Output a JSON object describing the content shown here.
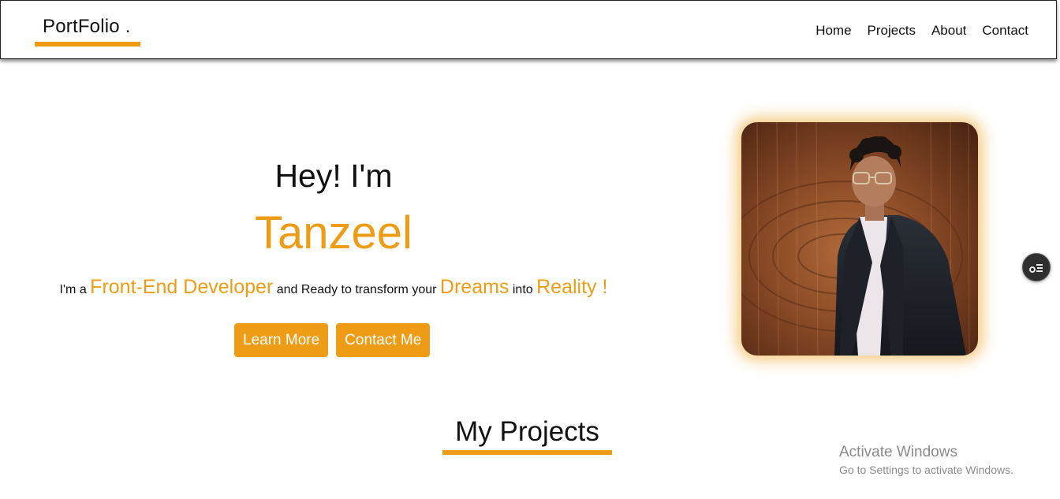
{
  "nav": {
    "logo": "PortFolio .",
    "links": [
      "Home",
      "Projects",
      "About",
      "Contact"
    ]
  },
  "hero": {
    "greeting": "Hey! I'm",
    "name": "Tanzeel",
    "tagline": {
      "t1": "I'm a",
      "h1": "Front-End Developer",
      "t2": "and Ready to transform your",
      "h2": "Dreams",
      "t3": "into",
      "h3": "Reality !"
    },
    "buttons": {
      "learn_more": "Learn More",
      "contact_me": "Contact Me"
    }
  },
  "projects": {
    "heading": "My Projects"
  },
  "watermark": {
    "title": "Activate Windows",
    "subtitle": "Go to Settings to activate Windows."
  },
  "colors": {
    "accent": "#ee9c15",
    "text": "#111111",
    "watermark": "#8a8a8a"
  },
  "icons": {
    "floating_widget": "settings-list-icon",
    "profile_photo": "profile-photo"
  }
}
